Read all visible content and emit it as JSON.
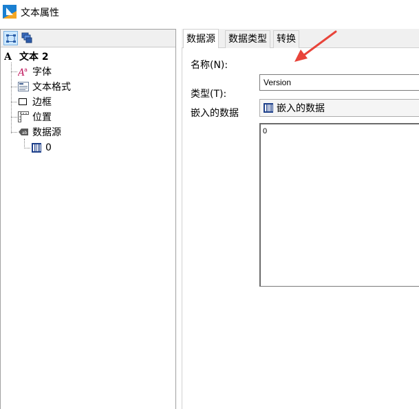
{
  "window": {
    "title": "文本属性",
    "icon": "app-logo-icon"
  },
  "left_toolbar": {
    "buttons": [
      {
        "icon": "tree-view-icon",
        "active": true
      },
      {
        "icon": "layers-icon",
        "active": false
      }
    ]
  },
  "tree": {
    "root": {
      "label": "文本 2",
      "icon": "text-a-icon"
    },
    "children": [
      {
        "label": "字体",
        "icon": "font-icon"
      },
      {
        "label": "文本格式",
        "icon": "text-format-icon"
      },
      {
        "label": "边框",
        "icon": "border-icon"
      },
      {
        "label": "位置",
        "icon": "position-ruler-icon"
      },
      {
        "label": "数据源",
        "icon": "data-source-icon"
      }
    ],
    "data_source_children": [
      {
        "label": "0",
        "icon": "embedded-data-icon"
      }
    ]
  },
  "tabs": [
    {
      "label": "数据源",
      "active": true
    },
    {
      "label": "数据类型",
      "active": false
    },
    {
      "label": "转换",
      "active": false
    }
  ],
  "form": {
    "name_label": "名称(N):",
    "name_value": "Version",
    "type_label": "类型(T):",
    "type_value": "嵌入的数据",
    "type_icon": "embedded-data-icon",
    "embedded_label": "嵌入的数据",
    "embedded_value": "0"
  },
  "annotation": {
    "arrow_color": "#e8443a"
  }
}
